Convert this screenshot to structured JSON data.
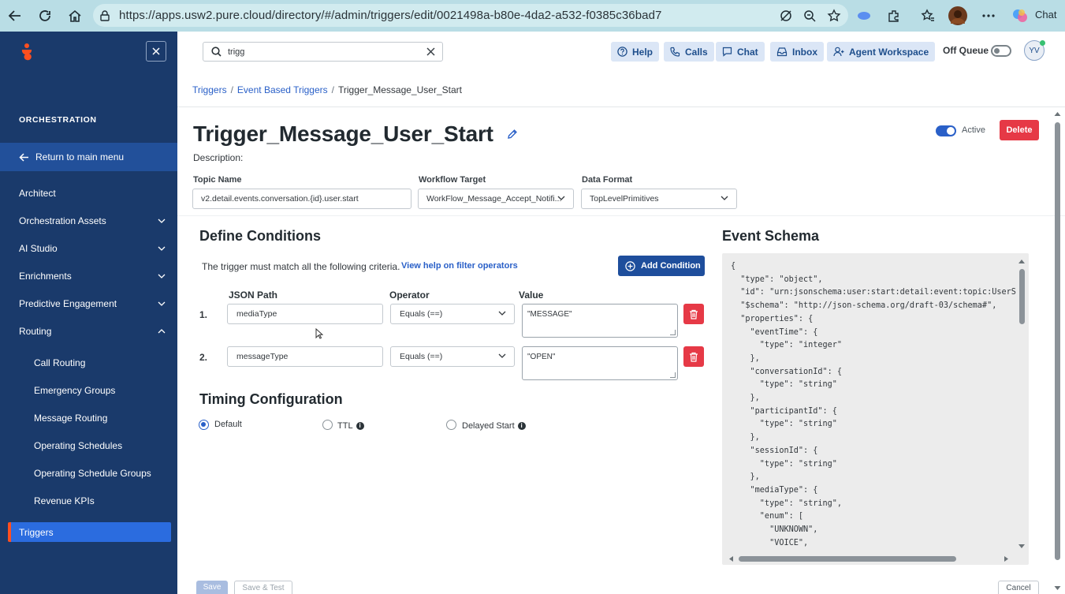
{
  "browser": {
    "url": "https://apps.usw2.pure.cloud/directory/#/admin/triggers/edit/0021498a-b80e-4da2-a532-f0385c36bad7",
    "chat_label": "Chat"
  },
  "sidebar": {
    "section": "ORCHESTRATION",
    "return_label": "Return to main menu",
    "items": [
      {
        "label": "Architect"
      },
      {
        "label": "Orchestration Assets"
      },
      {
        "label": "AI Studio"
      },
      {
        "label": "Enrichments"
      },
      {
        "label": "Predictive Engagement"
      },
      {
        "label": "Routing"
      }
    ],
    "routing_subitems": [
      "Call Routing",
      "Emergency Groups",
      "Message Routing",
      "Operating Schedules",
      "Operating Schedule Groups",
      "Revenue KPIs"
    ],
    "active_item": "Triggers"
  },
  "topbar": {
    "search_value": "trigg",
    "buttons": {
      "help": "Help",
      "calls": "Calls",
      "chat": "Chat",
      "inbox": "Inbox",
      "agent_workspace": "Agent Workspace"
    },
    "queue_status": "Off Queue",
    "avatar_initials": "YV"
  },
  "breadcrumb": [
    "Triggers",
    "Event Based Triggers",
    "Trigger_Message_User_Start"
  ],
  "page": {
    "title": "Trigger_Message_User_Start",
    "description_label": "Description:",
    "active_label": "Active",
    "delete_label": "Delete"
  },
  "form": {
    "topic_name_label": "Topic Name",
    "topic_name_value": "v2.detail.events.conversation.{id}.user.start",
    "workflow_target_label": "Workflow Target",
    "workflow_target_value": "WorkFlow_Message_Accept_Notifi...",
    "data_format_label": "Data Format",
    "data_format_value": "TopLevelPrimitives"
  },
  "conditions": {
    "heading": "Define Conditions",
    "criteria_text": "The trigger must match all the following criteria.",
    "help_link": "View help on filter operators",
    "add_label": "Add Condition",
    "col_json_path": "JSON Path",
    "col_operator": "Operator",
    "col_value": "Value",
    "rows": [
      {
        "num": "1.",
        "path": "mediaType",
        "operator": "Equals (==)",
        "value": "\"MESSAGE\""
      },
      {
        "num": "2.",
        "path": "messageType",
        "operator": "Equals (==)",
        "value": "\"OPEN\""
      }
    ]
  },
  "timing": {
    "heading": "Timing Configuration",
    "options": [
      "Default",
      "TTL",
      "Delayed Start"
    ],
    "selected": "Default"
  },
  "schema": {
    "heading": "Event Schema",
    "lines": [
      "{",
      "  \"type\": \"object\",",
      "  \"id\": \"urn:jsonschema:user:start:detail:event:topic:UserS",
      "  \"$schema\": \"http://json-schema.org/draft-03/schema#\",",
      "  \"properties\": {",
      "    \"eventTime\": {",
      "      \"type\": \"integer\"",
      "    },",
      "    \"conversationId\": {",
      "      \"type\": \"string\"",
      "    },",
      "    \"participantId\": {",
      "      \"type\": \"string\"",
      "    },",
      "    \"sessionId\": {",
      "      \"type\": \"string\"",
      "    },",
      "    \"mediaType\": {",
      "      \"type\": \"string\",",
      "      \"enum\": [",
      "        \"UNKNOWN\",",
      "        \"VOICE\","
    ]
  },
  "footer": {
    "save": "Save",
    "save_test": "Save & Test",
    "cancel": "Cancel"
  },
  "colors": {
    "sidebar": "#1a3a6b",
    "accent": "#2a60c8",
    "danger": "#e63946",
    "active_marker": "#ff4f1f"
  }
}
